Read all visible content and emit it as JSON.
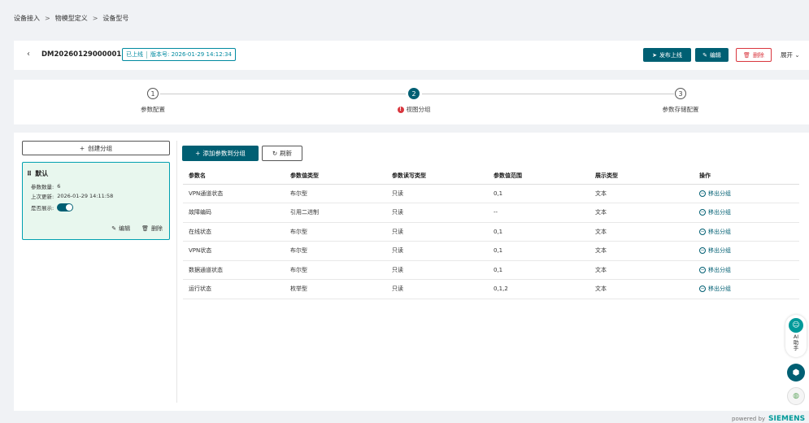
{
  "breadcrumb": {
    "items": [
      "设备接入",
      "物模型定义",
      "设备型号"
    ],
    "separator": ">"
  },
  "header": {
    "device_id": "DM20260129000001",
    "status": "已上线",
    "version": "版本号: 2026-01-29 14:12:34",
    "buttons": {
      "publish": "发布上线",
      "edit": "编辑",
      "delete": "删除",
      "expand": "展开"
    }
  },
  "steps": [
    {
      "number": "1",
      "label": "参数配置",
      "active": false,
      "warning": false
    },
    {
      "number": "2",
      "label": "视图分组",
      "active": true,
      "warning": true
    },
    {
      "number": "3",
      "label": "参数存储配置",
      "active": false,
      "warning": false
    }
  ],
  "sidebar": {
    "create_label": "创建分组",
    "group": {
      "name": "默认",
      "count_label": "参数数量:",
      "count_value": "6",
      "updated_label": "上次更新:",
      "updated_value": "2026-01-29 14:11:58",
      "display_label": "是否展示:",
      "display_on": true,
      "edit_label": "编辑",
      "delete_label": "删除"
    }
  },
  "toolbar": {
    "add_label": "添加参数到分组",
    "refresh_label": "刷新"
  },
  "table": {
    "columns": [
      "参数名",
      "参数值类型",
      "参数读写类型",
      "参数值范围",
      "展示类型",
      "操作"
    ],
    "rows": [
      [
        "VPN通道状态",
        "布尔型",
        "只读",
        "0,1",
        "文本",
        "移出分组"
      ],
      [
        "故障编码",
        "引用二进制",
        "只读",
        "--",
        "文本",
        "移出分组"
      ],
      [
        "在线状态",
        "布尔型",
        "只读",
        "0,1",
        "文本",
        "移出分组"
      ],
      [
        "VPN状态",
        "布尔型",
        "只读",
        "0,1",
        "文本",
        "移出分组"
      ],
      [
        "数据通道状态",
        "布尔型",
        "只读",
        "0,1",
        "文本",
        "移出分组"
      ],
      [
        "运行状态",
        "枚举型",
        "只读",
        "0,1,2",
        "文本",
        "移出分组"
      ]
    ]
  },
  "ai_widget": {
    "label": "AI助手"
  },
  "footer": {
    "powered": "powered by",
    "brand": "SIEMENS"
  },
  "colors": {
    "primary": "#005f73",
    "danger": "#d9363e",
    "accent": "#00a0b0",
    "group_bg": "#e8f7ee"
  }
}
